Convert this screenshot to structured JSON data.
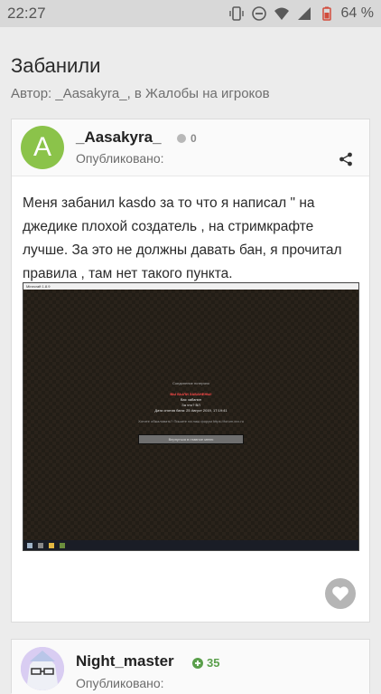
{
  "status": {
    "time": "22:27",
    "battery": "64 %"
  },
  "topic": {
    "title": "Забанили",
    "byline": "Автор: _Aasakyra_, в Жалобы на игроков"
  },
  "post1": {
    "author": "_Aasakyra_",
    "avatar_letter": "A",
    "reputation": "0",
    "published_label": "Опубликовано:",
    "text": "Меня забанил kasdo за то что я написал \" на джедике плохой создатель , на стримкрафте лучше. За это не должны давать бан, я прочитал правила , там нет такого пункта.",
    "screenshot": {
      "window_title": "Minecraft 1.8.9",
      "lines": [
        "Соединение потеряно",
        "ВЫ БЫЛИ ЗАБАНЕНЫ!",
        "Вас забанил",
        "За что? ВЛ",
        "Дата снятия бана: 25 Август 2019, 17:19:41",
        "Хотите обжаловать? Пишите на наш форум https://forum.xxx.ru"
      ],
      "button": "Вернуться в главное меню"
    }
  },
  "post2": {
    "author": "Night_master",
    "reputation": "35",
    "published_label": "Опубликовано:"
  },
  "colors": {
    "avatar": "#8bc34a",
    "rep_positive": "#5a9f4b",
    "like": "#b5b5b5"
  }
}
